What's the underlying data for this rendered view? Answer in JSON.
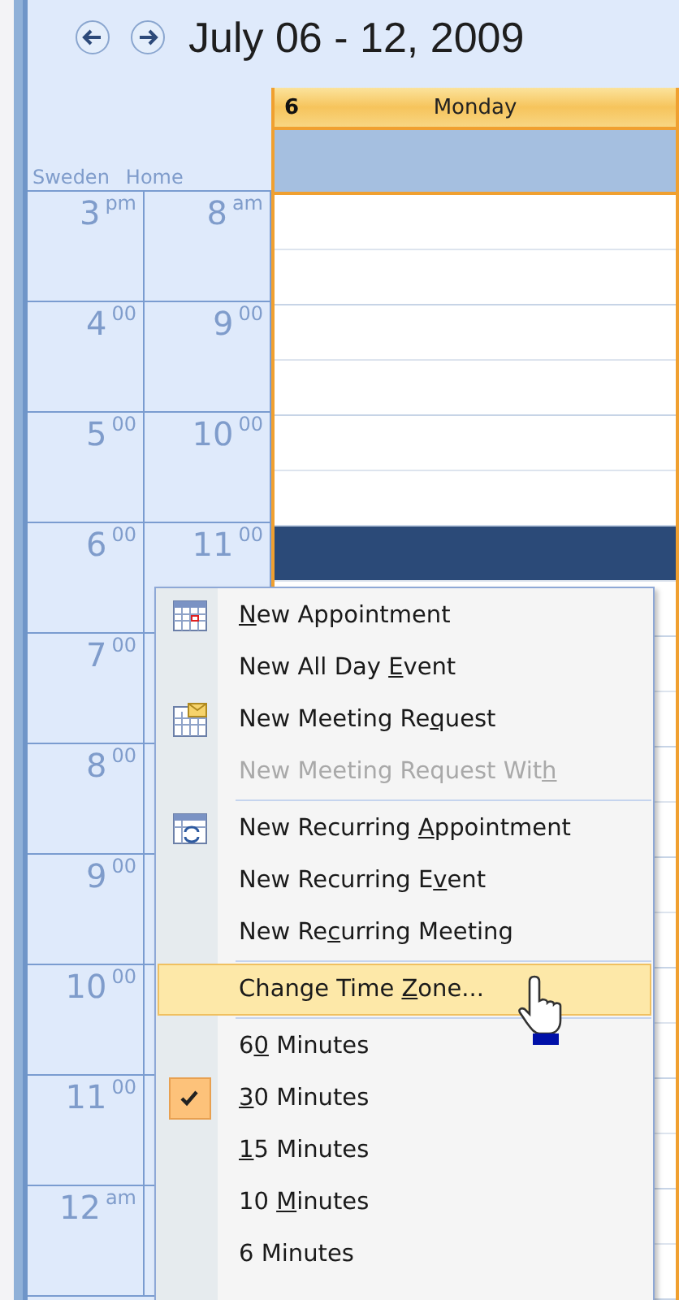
{
  "header": {
    "title": "July 06 - 12, 2009"
  },
  "day": {
    "number": "6",
    "name": "Monday"
  },
  "time_zones": [
    {
      "label": "Sweden"
    },
    {
      "label": "Home"
    }
  ],
  "hours": [
    {
      "sweden": "3",
      "sweden_suffix": "pm",
      "home": "8",
      "home_suffix": "am",
      "selected": false
    },
    {
      "sweden": "4",
      "sweden_suffix": "00",
      "home": "9",
      "home_suffix": "00",
      "selected": false
    },
    {
      "sweden": "5",
      "sweden_suffix": "00",
      "home": "10",
      "home_suffix": "00",
      "selected": false
    },
    {
      "sweden": "6",
      "sweden_suffix": "00",
      "home": "11",
      "home_suffix": "00",
      "selected": true
    },
    {
      "sweden": "7",
      "sweden_suffix": "00",
      "selected": false
    },
    {
      "sweden": "8",
      "sweden_suffix": "00",
      "selected": false
    },
    {
      "sweden": "9",
      "sweden_suffix": "00",
      "selected": false
    },
    {
      "sweden": "10",
      "sweden_suffix": "00",
      "selected": false
    },
    {
      "sweden": "11",
      "sweden_suffix": "00",
      "selected": false
    },
    {
      "sweden": "12",
      "sweden_suffix": "am",
      "selected": false
    }
  ],
  "context_menu": [
    {
      "kind": "calendar",
      "key": "N",
      "post": "ew Appointment",
      "disabled": false,
      "selected": false,
      "checked": false
    },
    {
      "kind": "text",
      "pre": "New All Day ",
      "key": "E",
      "post": "vent",
      "disabled": false,
      "selected": false,
      "checked": false
    },
    {
      "kind": "meeting",
      "pre": "New Meeting Re",
      "key": "q",
      "post": "uest",
      "disabled": false,
      "selected": false,
      "checked": false
    },
    {
      "kind": "text",
      "pre": "New Meeting Request Wit",
      "key": "h",
      "disabled": true,
      "selected": false,
      "checked": false
    },
    {
      "kind": "separator"
    },
    {
      "kind": "recurring",
      "pre": "New Recurring ",
      "key": "A",
      "post": "ppointment",
      "disabled": false,
      "selected": false,
      "checked": false
    },
    {
      "kind": "text",
      "pre": "New Recurring E",
      "key": "v",
      "post": "ent",
      "disabled": false,
      "selected": false,
      "checked": false
    },
    {
      "kind": "text",
      "pre": "New Re",
      "key": "c",
      "post": "urring Meeting",
      "disabled": false,
      "selected": false,
      "checked": false
    },
    {
      "kind": "separator"
    },
    {
      "kind": "text",
      "pre": "Change Time ",
      "key": "Z",
      "post": "one...",
      "disabled": false,
      "selected": true,
      "checked": false
    },
    {
      "kind": "separator"
    },
    {
      "kind": "text",
      "pre": "6",
      "key": "0",
      "post": " Minutes",
      "disabled": false,
      "selected": false,
      "checked": false
    },
    {
      "kind": "text",
      "key": "3",
      "post": "0 Minutes",
      "disabled": false,
      "selected": false,
      "checked": true
    },
    {
      "kind": "text",
      "key": "1",
      "post": "5 Minutes",
      "disabled": false,
      "selected": false,
      "checked": false
    },
    {
      "kind": "text",
      "pre": "10 ",
      "key": "M",
      "post": "inutes",
      "disabled": false,
      "selected": false,
      "checked": false
    },
    {
      "kind": "text",
      "pre": "6 Minutes",
      "disabled": false,
      "selected": false,
      "checked": false
    }
  ]
}
